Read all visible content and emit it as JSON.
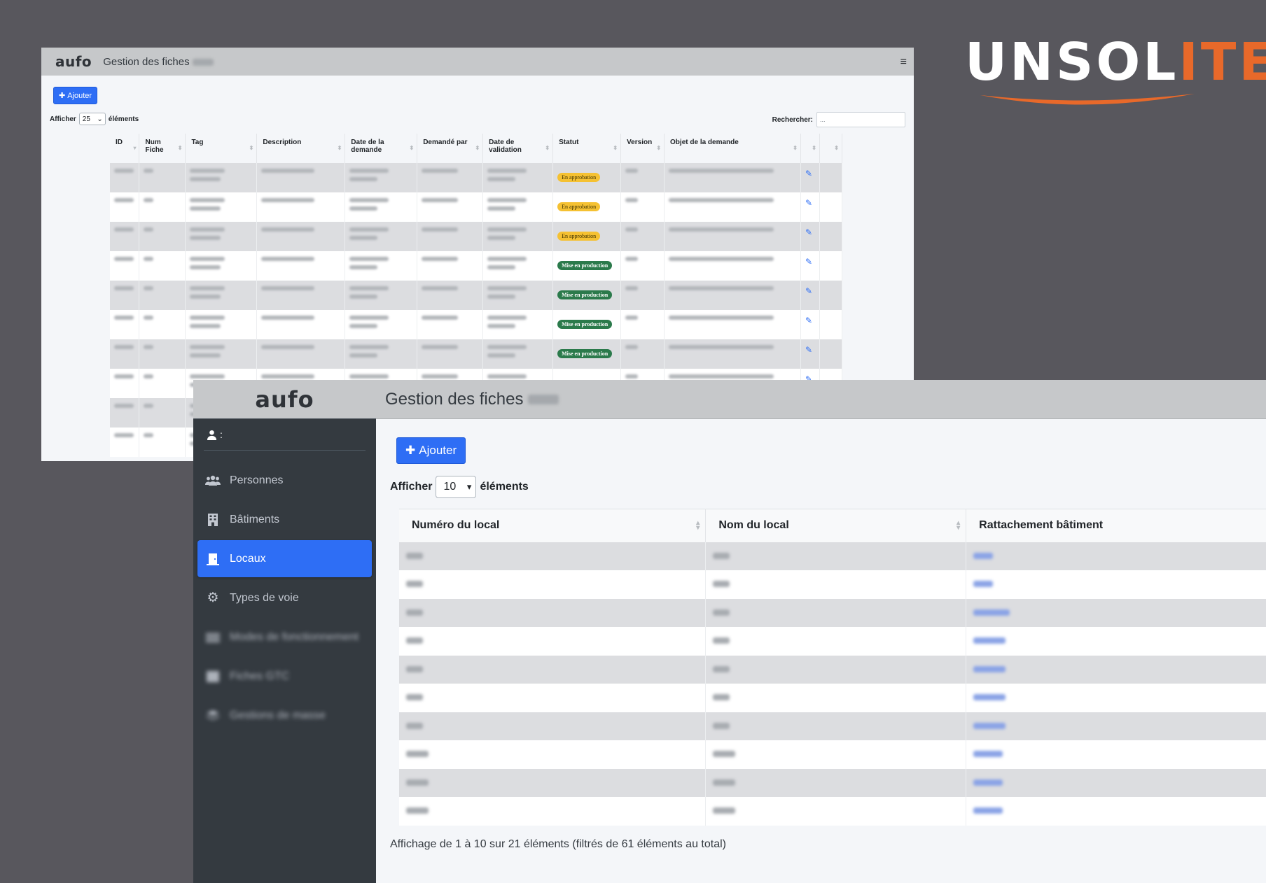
{
  "brand": {
    "text_main": "UNSOL",
    "text_accent": "ITE",
    "accent_color": "#e8692a",
    "text_color": "#ffffff"
  },
  "back_window": {
    "logo": "aufo",
    "title": "Gestion des fiches",
    "add_button": "Ajouter",
    "length": {
      "prefix": "Afficher",
      "value": "25",
      "suffix": "éléments"
    },
    "search": {
      "label": "Rechercher:",
      "placeholder": "..."
    },
    "columns": [
      "ID",
      "Num Fiche",
      "Tag",
      "Description",
      "Date de la demande",
      "Demandé par",
      "Date de validation",
      "Statut",
      "Version",
      "Objet de la demande",
      "",
      ""
    ],
    "statuses": [
      "En approbation",
      "En approbation",
      "En approbation",
      "Mise en production",
      "Mise en production",
      "Mise en production",
      "Mise en production",
      "",
      "",
      ""
    ]
  },
  "front_window": {
    "logo": "aufo",
    "user_label": ":",
    "title": "Gestion des fiches",
    "nav": [
      {
        "label": "Personnes",
        "icon": "users-icon",
        "active": false
      },
      {
        "label": "Bâtiments",
        "icon": "building-icon",
        "active": false
      },
      {
        "label": "Locaux",
        "icon": "door-icon",
        "active": true
      },
      {
        "label": "Types de voie",
        "icon": "gear-icon",
        "active": false
      },
      {
        "label": "Modes de fonctionnement",
        "icon": "sliders-icon",
        "active": false
      },
      {
        "label": "Fiches GTC",
        "icon": "table-icon",
        "active": false
      },
      {
        "label": "Gestions de masse",
        "icon": "layers-icon",
        "active": false
      }
    ],
    "add_button": "Ajouter",
    "length": {
      "prefix": "Afficher",
      "value": "10",
      "suffix": "éléments"
    },
    "columns": [
      "Numéro du local",
      "Nom du local",
      "Rattachement bâtiment"
    ],
    "info": "Affichage de 1 à 10 sur 21 éléments (filtrés de 61 éléments au total)"
  }
}
